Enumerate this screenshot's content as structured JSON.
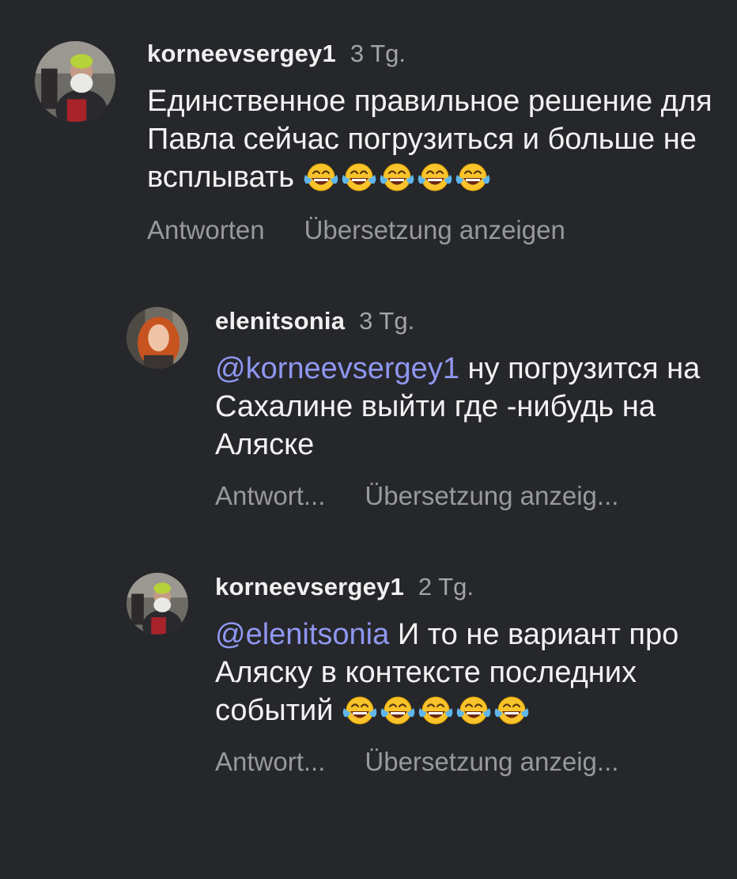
{
  "comments": [
    {
      "username": "korneevsergey1",
      "time": "3 Tg.",
      "mention": "",
      "text": "Единственное правильное решение для Павла сейчас погрузиться и больше не всплывать",
      "emoji_count": 5,
      "reply_label": "Antworten",
      "translate_label": "Übersetzung anzeigen"
    },
    {
      "username": "elenitsonia",
      "time": "3 Tg.",
      "mention": "@korneevsergey1",
      "text": "ну погрузится на Сахалине выйти где -нибудь на Аляске",
      "emoji_count": 0,
      "reply_label": "Antwort...",
      "translate_label": "Übersetzung anzeig..."
    },
    {
      "username": "korneevsergey1",
      "time": "2 Tg.",
      "mention": "@elenitsonia",
      "text": "И то не вариант про Аляску в контексте последних событий",
      "emoji_count": 5,
      "reply_label": "Antwort...",
      "translate_label": "Übersetzung anzeig..."
    }
  ],
  "colors": {
    "background": "#26272b",
    "mention": "#8f97f0",
    "secondary_text": "#98999d"
  },
  "icons": {
    "emoji": "face-with-tears-of-joy-icon"
  }
}
